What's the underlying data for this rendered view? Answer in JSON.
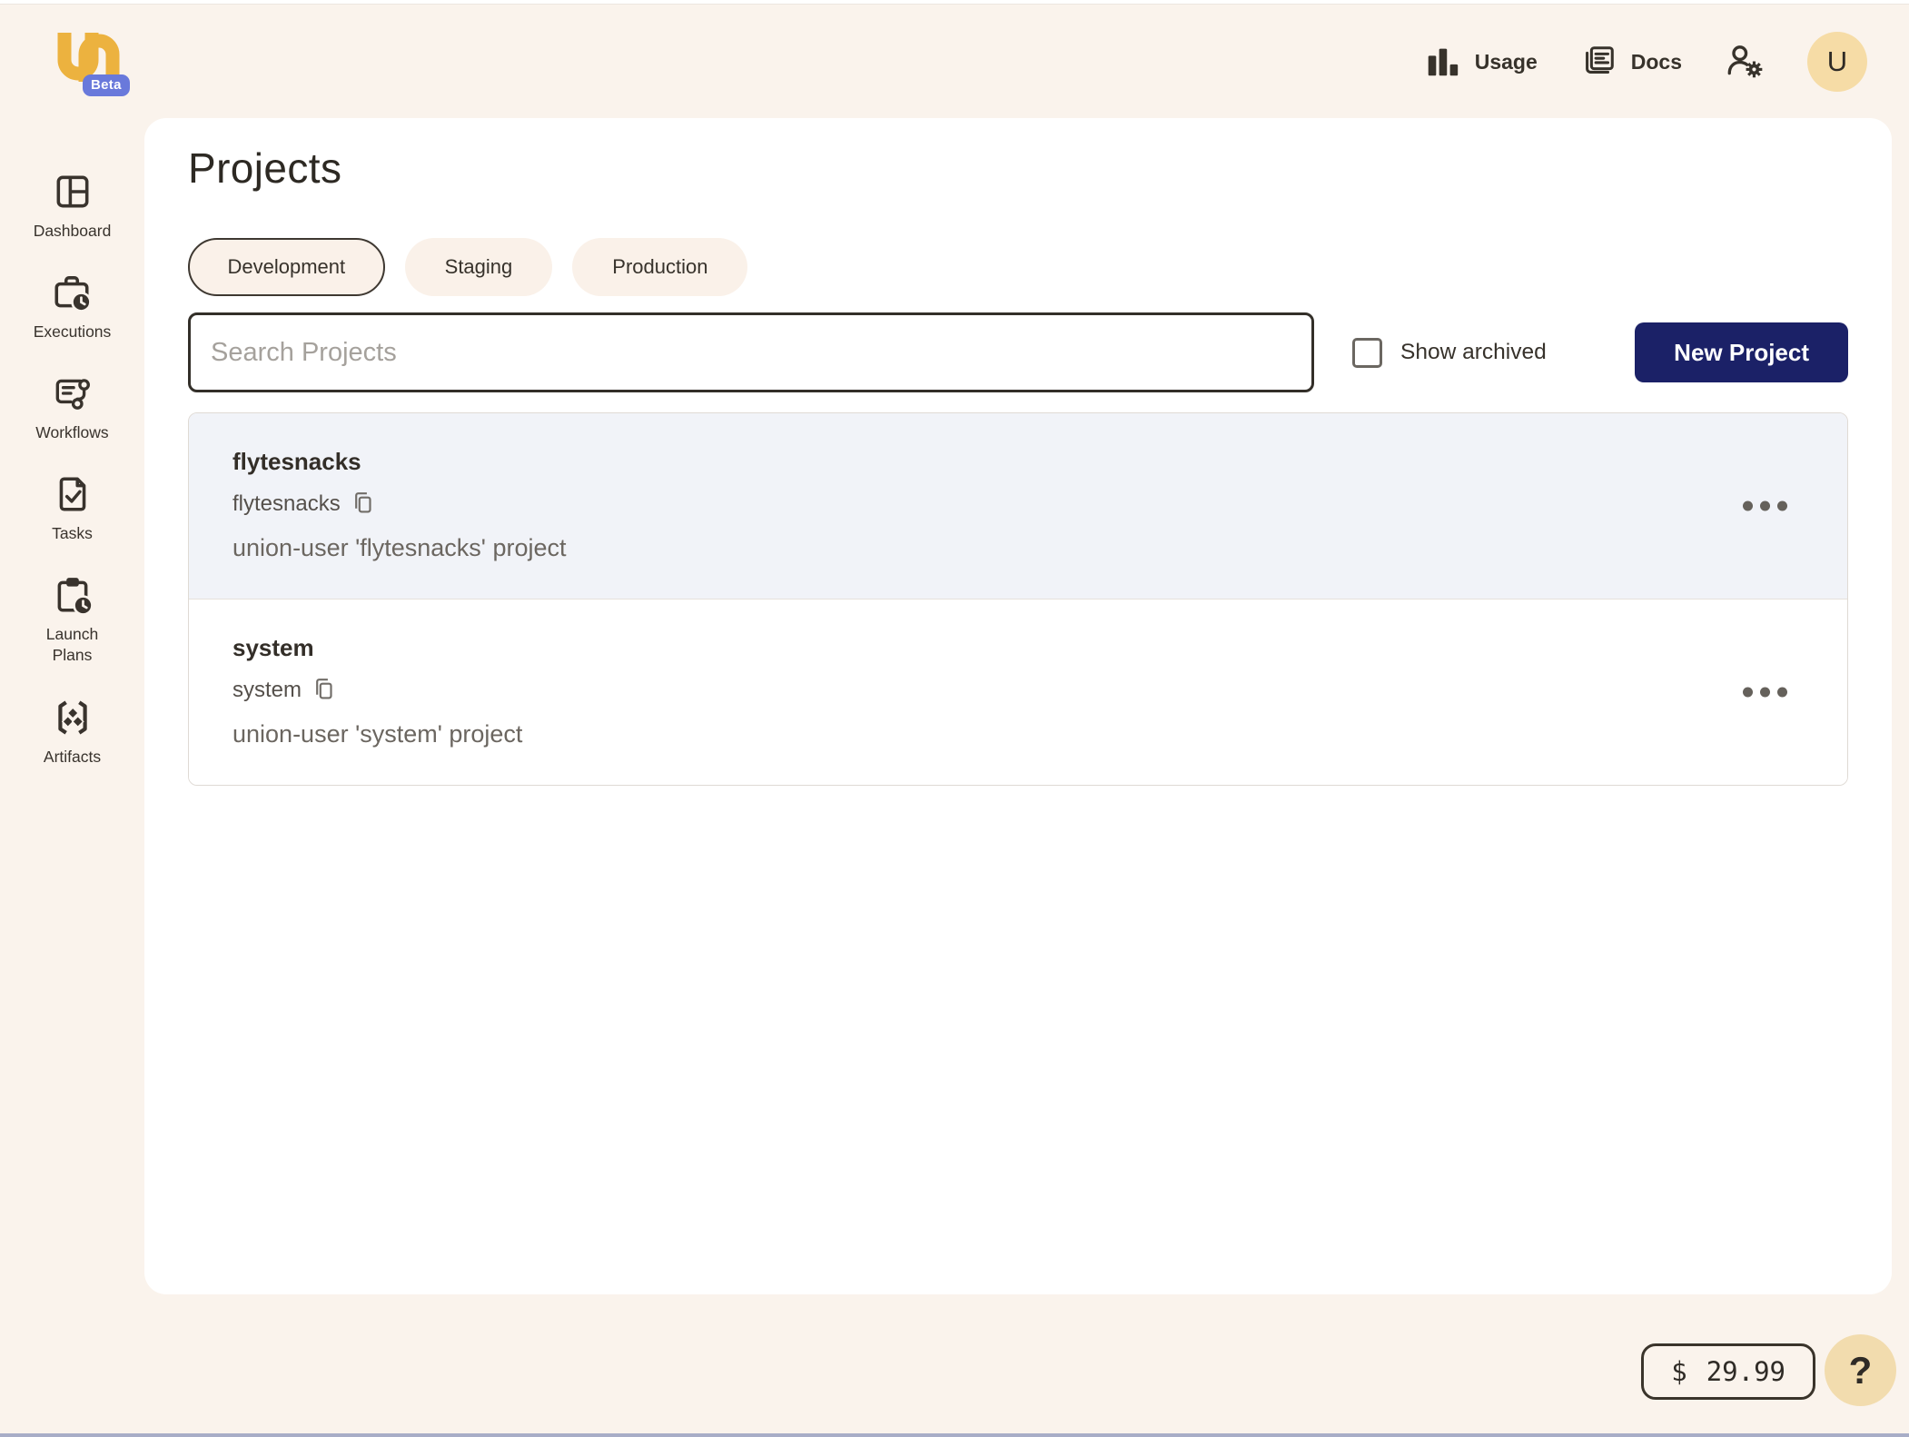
{
  "header": {
    "beta_label": "Beta",
    "usage_label": "Usage",
    "docs_label": "Docs",
    "avatar_initial": "U"
  },
  "sidebar": {
    "items": [
      {
        "label": "Dashboard",
        "icon": "dashboard-icon"
      },
      {
        "label": "Executions",
        "icon": "executions-icon"
      },
      {
        "label": "Workflows",
        "icon": "workflows-icon"
      },
      {
        "label": "Tasks",
        "icon": "tasks-icon"
      },
      {
        "label": "Launch Plans",
        "icon": "launch-plans-icon"
      },
      {
        "label": "Artifacts",
        "icon": "artifacts-icon"
      }
    ]
  },
  "main": {
    "title": "Projects",
    "tabs": [
      {
        "label": "Development",
        "selected": true
      },
      {
        "label": "Staging",
        "selected": false
      },
      {
        "label": "Production",
        "selected": false
      }
    ],
    "search": {
      "placeholder": "Search Projects",
      "value": ""
    },
    "show_archived_label": "Show archived",
    "show_archived_checked": false,
    "new_project_label": "New Project",
    "projects": [
      {
        "name": "flytesnacks",
        "id": "flytesnacks",
        "description": "union-user 'flytesnacks' project",
        "highlighted": true
      },
      {
        "name": "system",
        "id": "system",
        "description": "union-user 'system' project",
        "highlighted": false
      }
    ]
  },
  "footer": {
    "currency": "$",
    "amount": "29.99",
    "help_label": "?"
  },
  "colors": {
    "page_background": "#FAF3EC",
    "panel_background": "#FFFFFF",
    "accent_navy": "#1B2167",
    "logo_gold": "#ECB23F",
    "beta_badge": "#6979DB",
    "avatar_background": "#F6DCA6",
    "help_background": "#F2DCAE",
    "row_highlight": "#F1F3F8",
    "text_dark": "#37322B",
    "text_gray": "#6B6660",
    "bottom_bar": "#A8ADC7"
  }
}
